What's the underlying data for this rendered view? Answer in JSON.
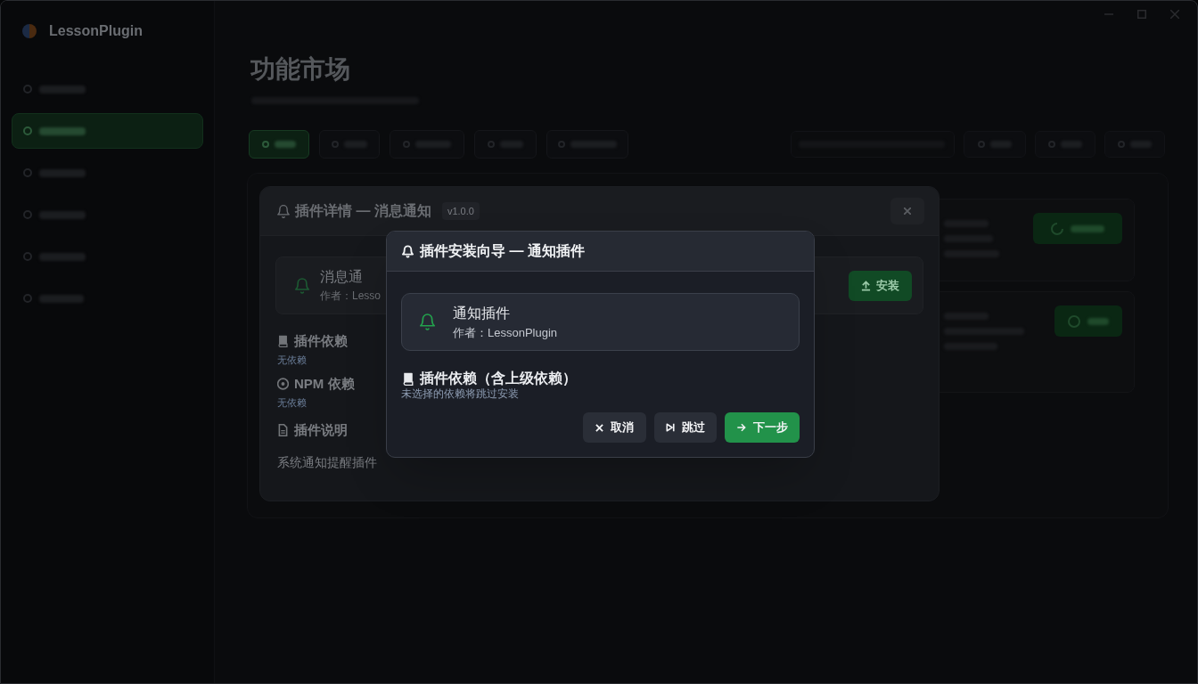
{
  "app": {
    "name": "LessonPlugin",
    "sidebar": {
      "items": [
        {
          "selected": false
        },
        {
          "selected": true
        },
        {
          "selected": false
        },
        {
          "selected": false
        },
        {
          "selected": false
        },
        {
          "selected": false
        }
      ]
    },
    "page": {
      "title": "功能市场",
      "filter_tabs": [
        {
          "selected": true
        },
        {
          "selected": false
        },
        {
          "selected": false
        },
        {
          "selected": false
        },
        {
          "selected": false
        }
      ]
    }
  },
  "plugin_details_dialog": {
    "title": "插件详情 — 消息通知",
    "version": "v1.0.0",
    "plugin": {
      "name": "消息通",
      "author": "作者：Lesso"
    },
    "install_button": "安装",
    "sections": [
      {
        "kind": "note",
        "heading": "插件依赖",
        "text": "无依赖"
      },
      {
        "kind": "note",
        "heading": "NPM 依赖",
        "text": "无依赖"
      },
      {
        "kind": "paragraph",
        "heading": "插件说明",
        "text": "系统通知提醒插件"
      }
    ]
  },
  "install_wizard": {
    "title": "插件安装向导 — 通知插件",
    "plugin": {
      "name": "通知插件",
      "author": "作者：LessonPlugin"
    },
    "dependencies": {
      "heading": "插件依赖（含上级依赖）",
      "hint": "未选择的依赖将跳过安装"
    },
    "buttons": [
      {
        "kind": "cancel",
        "label": "取消"
      },
      {
        "kind": "skip",
        "label": "跳过"
      },
      {
        "kind": "primary",
        "label": "下一步"
      }
    ]
  }
}
